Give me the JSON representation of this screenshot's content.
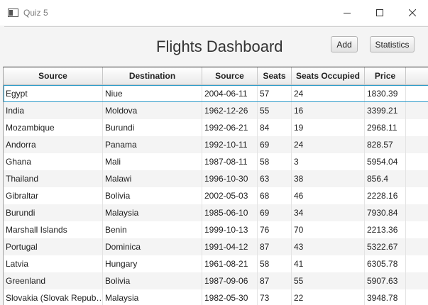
{
  "window": {
    "title": "Quiz 5"
  },
  "header": {
    "title": "Flights Dashboard",
    "add_label": "Add",
    "stats_label": "Statistics"
  },
  "table": {
    "columns": [
      "Source",
      "Destination",
      "Source",
      "Seats",
      "Seats Occupied",
      "Price"
    ],
    "rows": [
      [
        "Egypt",
        "Niue",
        "2004-06-11",
        "57",
        "24",
        "1830.39"
      ],
      [
        "India",
        "Moldova",
        "1962-12-26",
        "55",
        "16",
        "3399.21"
      ],
      [
        "Mozambique",
        "Burundi",
        "1992-06-21",
        "84",
        "19",
        "2968.11"
      ],
      [
        "Andorra",
        "Panama",
        "1992-10-11",
        "69",
        "24",
        "828.57"
      ],
      [
        "Ghana",
        "Mali",
        "1987-08-11",
        "58",
        "3",
        "5954.04"
      ],
      [
        "Thailand",
        "Malawi",
        "1996-10-30",
        "63",
        "38",
        "856.4"
      ],
      [
        "Gibraltar",
        "Bolivia",
        "2002-05-03",
        "68",
        "46",
        "2228.16"
      ],
      [
        "Burundi",
        "Malaysia",
        "1985-06-10",
        "69",
        "34",
        "7930.84"
      ],
      [
        "Marshall Islands",
        "Benin",
        "1999-10-13",
        "76",
        "70",
        "2213.36"
      ],
      [
        "Portugal",
        "Dominica",
        "1991-04-12",
        "87",
        "43",
        "5322.67"
      ],
      [
        "Latvia",
        "Hungary",
        "1961-08-21",
        "58",
        "41",
        "6305.78"
      ],
      [
        "Greenland",
        "Bolivia",
        "1987-09-06",
        "87",
        "55",
        "5907.63"
      ],
      [
        "Slovakia (Slovak Repub…",
        "Malaysia",
        "1982-05-30",
        "73",
        "22",
        "3948.78"
      ]
    ]
  }
}
